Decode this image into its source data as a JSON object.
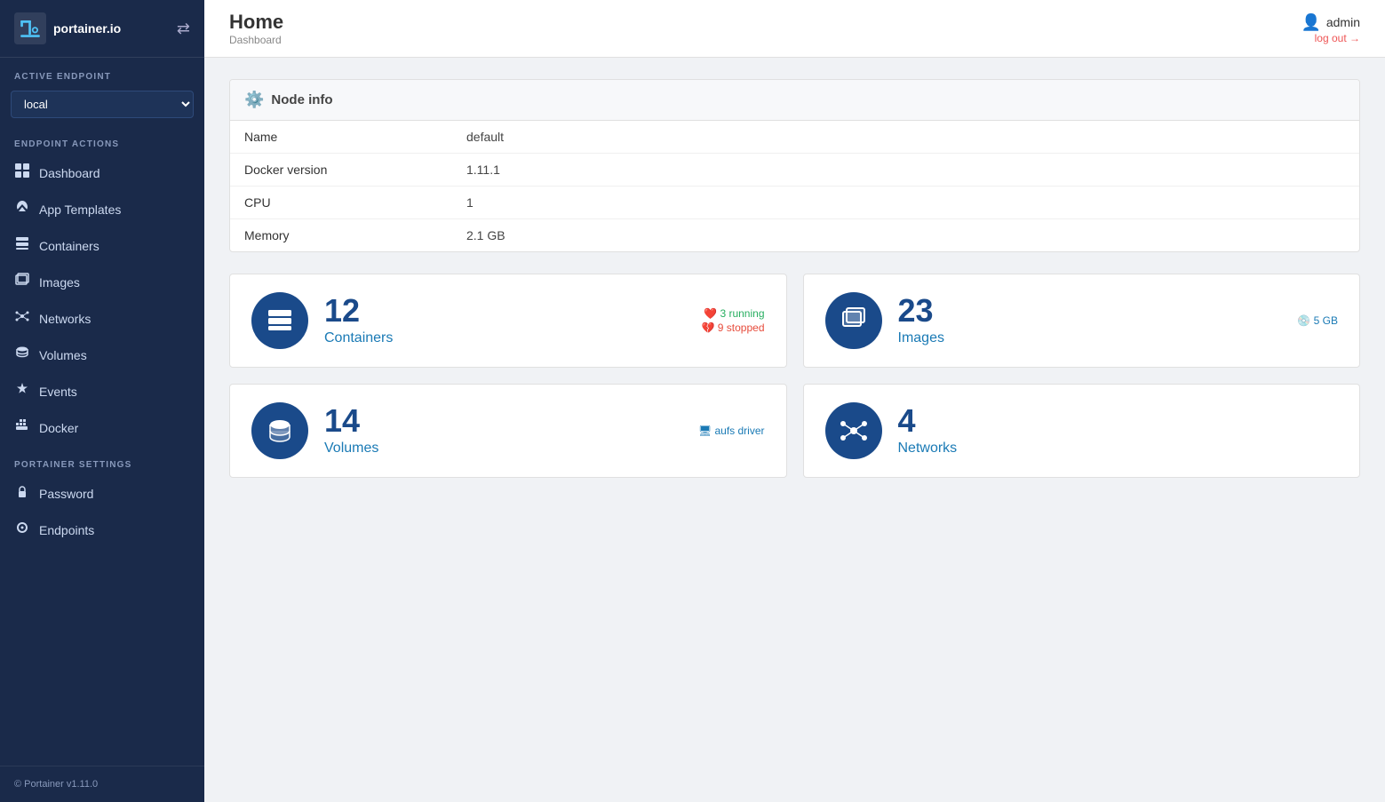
{
  "sidebar": {
    "logo_text": "portainer.io",
    "toggle_icon": "⇄",
    "active_endpoint_label": "ACTIVE ENDPOINT",
    "active_endpoint_value": "local",
    "endpoint_actions_label": "ENDPOINT ACTIONS",
    "portainer_settings_label": "PORTAINER SETTINGS",
    "nav_items": [
      {
        "id": "dashboard",
        "label": "Dashboard",
        "icon": "dashboard"
      },
      {
        "id": "app-templates",
        "label": "App Templates",
        "icon": "rocket"
      },
      {
        "id": "containers",
        "label": "Containers",
        "icon": "containers"
      },
      {
        "id": "images",
        "label": "Images",
        "icon": "images"
      },
      {
        "id": "networks",
        "label": "Networks",
        "icon": "network"
      },
      {
        "id": "volumes",
        "label": "Volumes",
        "icon": "volumes"
      },
      {
        "id": "events",
        "label": "Events",
        "icon": "events"
      },
      {
        "id": "docker",
        "label": "Docker",
        "icon": "docker"
      }
    ],
    "settings_items": [
      {
        "id": "password",
        "label": "Password",
        "icon": "lock"
      },
      {
        "id": "endpoints",
        "label": "Endpoints",
        "icon": "endpoints"
      }
    ],
    "footer": "© Portainer v1.11.0"
  },
  "topbar": {
    "title": "Home",
    "breadcrumb": "Dashboard",
    "user_icon": "👤",
    "user_name": "admin",
    "logout_label": "log out →"
  },
  "node_info": {
    "section_title": "Node info",
    "rows": [
      {
        "label": "Name",
        "value": "default"
      },
      {
        "label": "Docker version",
        "value": "1.11.1"
      },
      {
        "label": "CPU",
        "value": "1"
      },
      {
        "label": "Memory",
        "value": "2.1 GB"
      }
    ]
  },
  "stats": [
    {
      "id": "containers",
      "number": "12",
      "label": "Containers",
      "meta_running": "3 running",
      "meta_stopped": "9 stopped",
      "icon": "containers"
    },
    {
      "id": "images",
      "number": "23",
      "label": "Images",
      "meta_disk": "5 GB",
      "icon": "images"
    },
    {
      "id": "volumes",
      "number": "14",
      "label": "Volumes",
      "meta_driver": "aufs driver",
      "icon": "volumes"
    },
    {
      "id": "networks",
      "number": "4",
      "label": "Networks",
      "icon": "networks"
    }
  ],
  "colors": {
    "sidebar_bg": "#1a2a4a",
    "accent_blue": "#1a4a8a",
    "link_blue": "#1a7ab5",
    "running_green": "#27ae60",
    "stopped_red": "#e74c3c"
  }
}
